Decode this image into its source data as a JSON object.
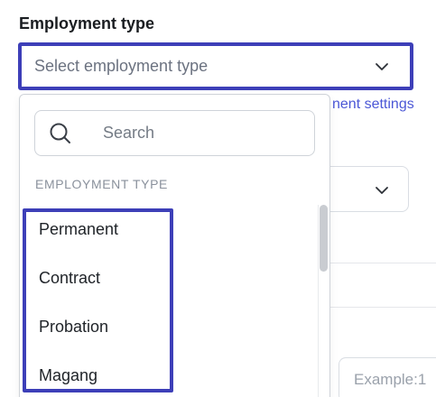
{
  "field": {
    "label": "Employment type",
    "placeholder": "Select employment type"
  },
  "background": {
    "link_text": "nent settings",
    "input_placeholder": "Example:1"
  },
  "dropdown": {
    "search_placeholder": "Search",
    "section_heading": "EMPLOYMENT TYPE",
    "options": [
      {
        "label": "Permanent"
      },
      {
        "label": "Contract"
      },
      {
        "label": "Probation"
      },
      {
        "label": "Magang"
      }
    ]
  },
  "colors": {
    "highlight": "#3d3fb8",
    "link": "#4b57d6",
    "placeholder": "#6b7280",
    "border": "#cfd3d9"
  },
  "icons": {
    "trigger": "chevron-down-icon",
    "search": "search-icon"
  }
}
